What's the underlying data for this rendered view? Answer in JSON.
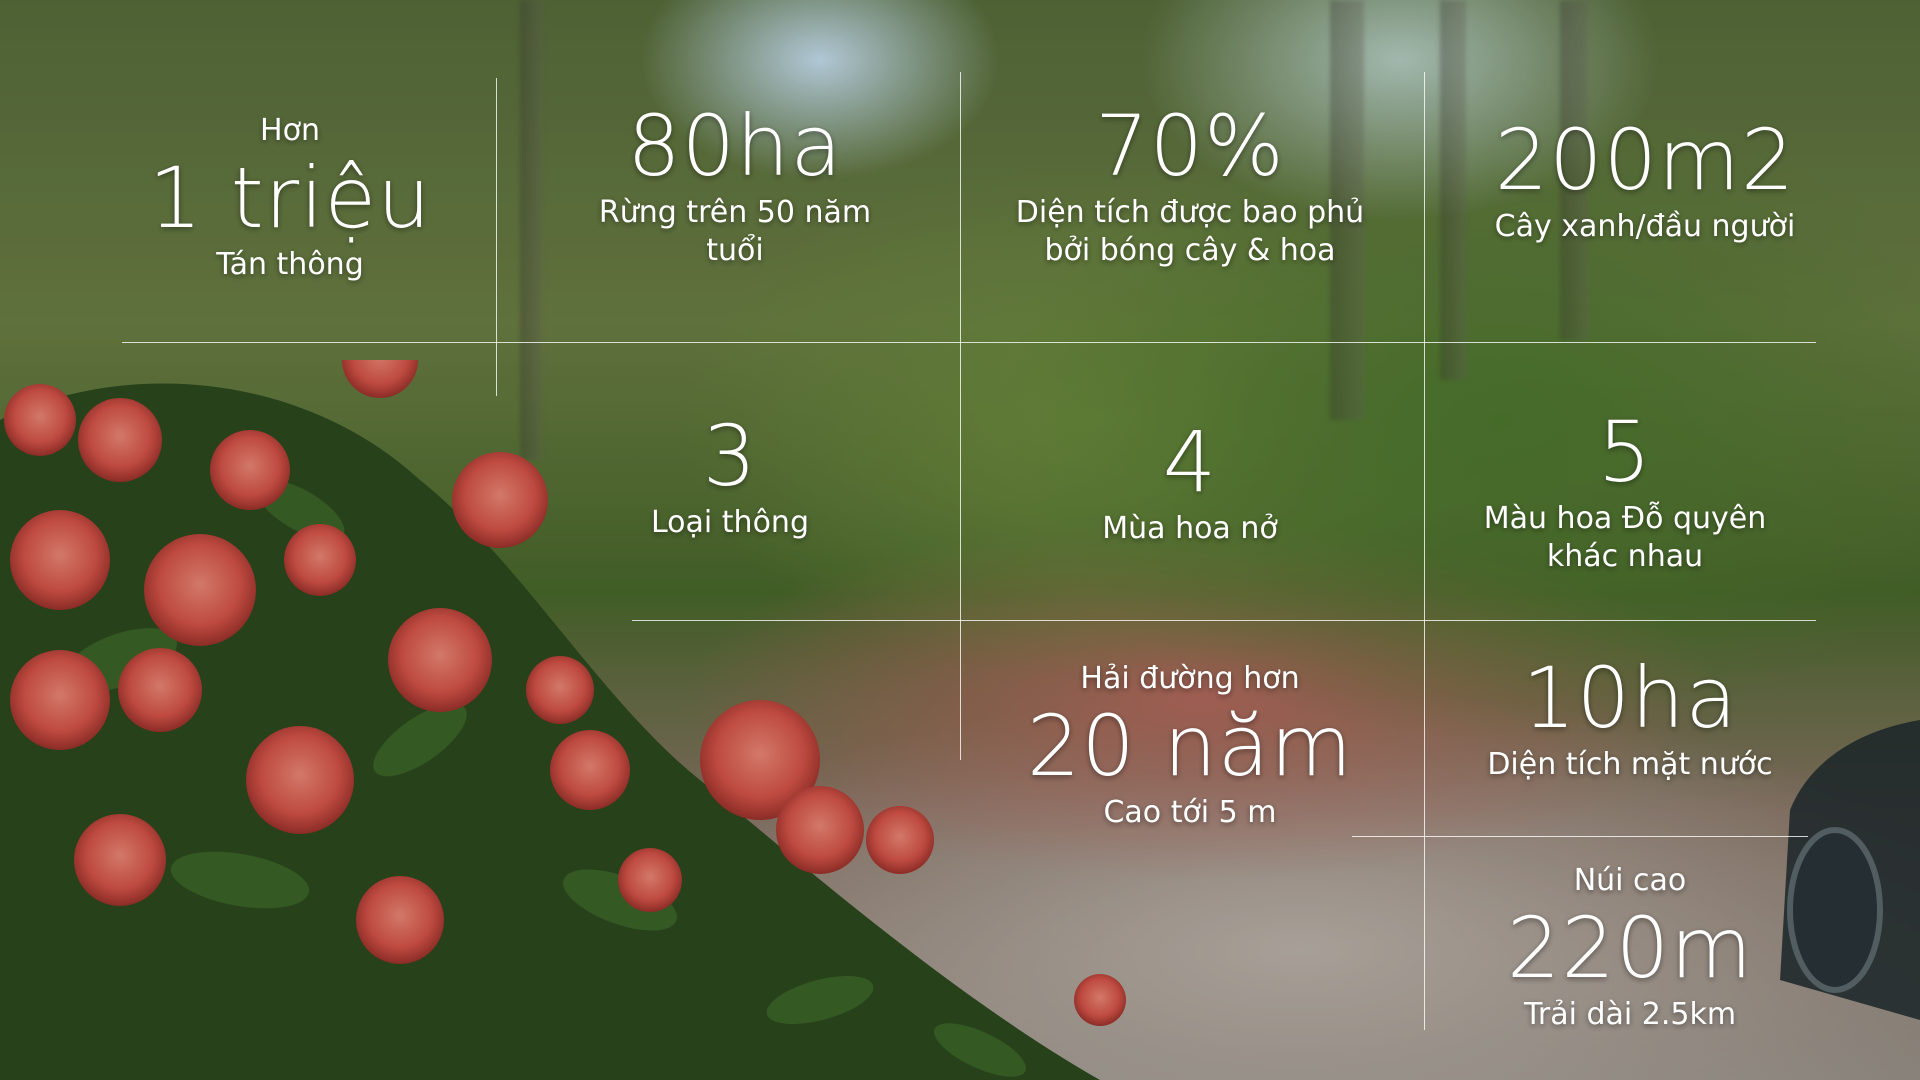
{
  "stats": [
    {
      "pre": "Hơn",
      "value": "1 triệu",
      "label": "Tán thông"
    },
    {
      "value": "80ha",
      "label": "Rừng trên 50 năm tuổi"
    },
    {
      "value": "70%",
      "label": "Diện tích được bao phủ bởi bóng cây & hoa"
    },
    {
      "value": "200m2",
      "label": "Cây xanh/đầu người"
    },
    {
      "value": "3",
      "label": "Loại thông"
    },
    {
      "value": "4",
      "label": "Mùa hoa nở"
    },
    {
      "value": "5",
      "label": "Màu hoa Đỗ quyên khác nhau"
    },
    {
      "pre": "Hải đường hơn",
      "value": "20 năm",
      "label": "Cao tới 5 m"
    },
    {
      "value": "10ha",
      "label": "Diện tích mặt nước"
    },
    {
      "pre": "Núi cao",
      "value": "220m",
      "label": "Trải dài 2.5km"
    }
  ],
  "colors": {
    "text": "#ffffff",
    "lines": "#ffffff",
    "rose": "#d9554a",
    "foliage": "#3f6a2a"
  }
}
